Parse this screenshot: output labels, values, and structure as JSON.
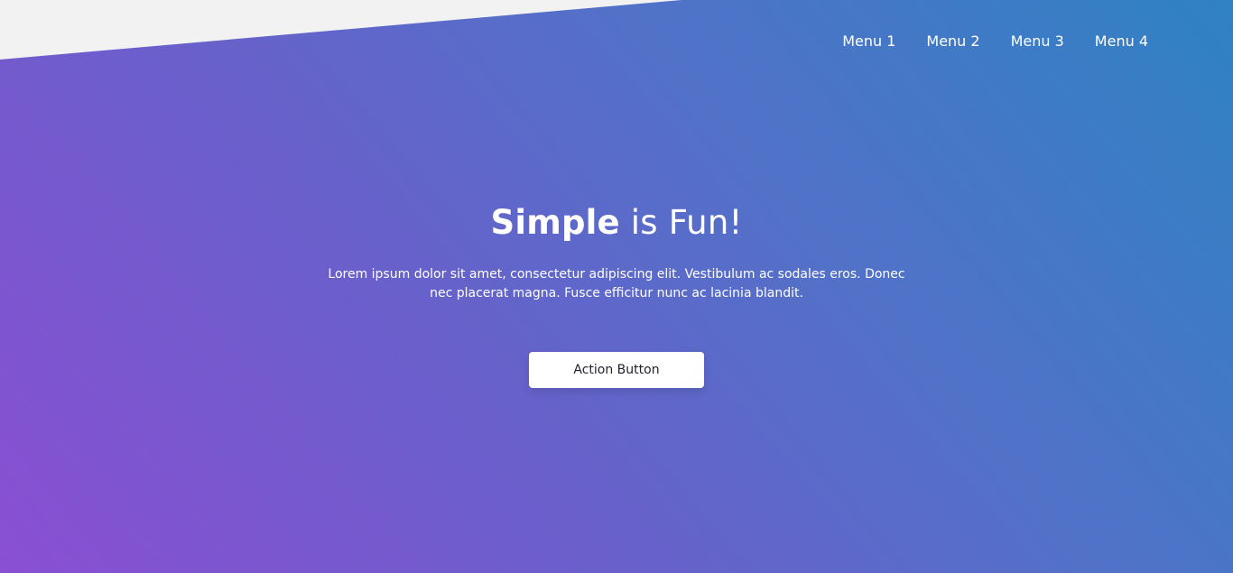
{
  "nav": {
    "items": [
      {
        "label": "Menu 1"
      },
      {
        "label": "Menu 2"
      },
      {
        "label": "Menu 3"
      },
      {
        "label": "Menu 4"
      }
    ]
  },
  "hero": {
    "title_strong": "Simple",
    "title_rest": " is Fun!",
    "text": "Lorem ipsum dolor sit amet, consectetur adipiscing elit. Vestibulum ac sodales eros. Donec nec placerat magna. Fusce efficitur nunc ac lacinia blandit.",
    "button_label": "Action Button"
  },
  "colors": {
    "gradient_start": "#8a4fd3",
    "gradient_end": "#2f82c4",
    "corner": "#f2f2f2",
    "button_bg": "#ffffff"
  }
}
